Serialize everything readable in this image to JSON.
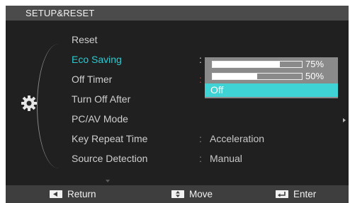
{
  "header": {
    "title": "SETUP&RESET"
  },
  "menu": {
    "items": [
      {
        "label": "Reset"
      },
      {
        "label": "Eco Saving"
      },
      {
        "label": "Off Timer"
      },
      {
        "label": "Turn Off After"
      },
      {
        "label": "PC/AV Mode"
      },
      {
        "label": "Key Repeat Time",
        "value": "Acceleration"
      },
      {
        "label": "Source Detection",
        "value": "Manual"
      }
    ],
    "active_index": 1
  },
  "dropdown": {
    "options": [
      {
        "label": "75%",
        "level": 0.75
      },
      {
        "label": "50%",
        "level": 0.5
      },
      {
        "label": "Off",
        "selected": true
      }
    ]
  },
  "footer": {
    "return_label": "Return",
    "move_label": "Move",
    "enter_label": "Enter"
  },
  "colors": {
    "accent": "#3fd3d6",
    "active_text": "#2ec9cf",
    "background": "#202020",
    "header": "#4b4b4b",
    "footer": "#3e3e3e"
  },
  "icons": {
    "category": "gear-icon",
    "return": "return-icon",
    "move": "move-icon",
    "enter": "enter-icon"
  }
}
